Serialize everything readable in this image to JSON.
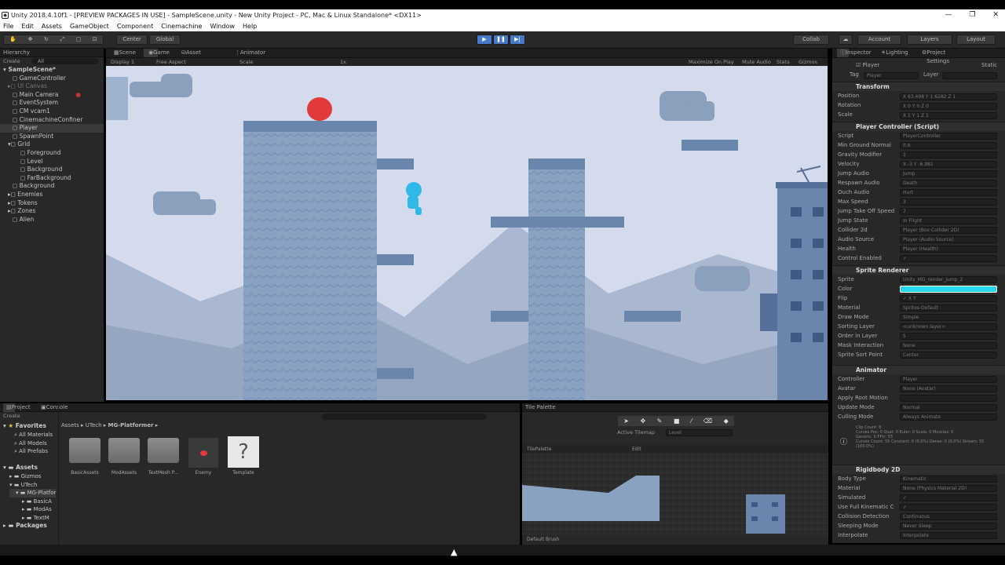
{
  "window": {
    "title": "Unity 2018.4.10f1 - [PREVIEW PACKAGES IN USE] - SampleScene.unity - New Unity Project - PC, Mac & Linux Standalone* <DX11>",
    "min": "—",
    "max": "❐",
    "close": "✕"
  },
  "menu": [
    "File",
    "Edit",
    "Assets",
    "GameObject",
    "Component",
    "Cinemachine",
    "Window",
    "Help"
  ],
  "toolbar": {
    "center": "Center",
    "global": "Global",
    "collab": "Collab",
    "account": "Account",
    "layers": "Layers",
    "layout": "Layout"
  },
  "scene_tabs": {
    "scene": "Scene",
    "game": "Game",
    "asset_store": "Asset Store",
    "animator": "Animator"
  },
  "game_bar": {
    "display": "Display 1",
    "aspect": "Free Aspect",
    "scale_label": "Scale",
    "scale_value": "1x",
    "maximize": "Maximize On Play",
    "mute": "Mute Audio",
    "stats": "Stats",
    "gizmos": "Gizmos"
  },
  "hierarchy": {
    "tab": "Hierarchy",
    "create": "Create",
    "search": "All",
    "items": [
      "SampleScene*",
      "GameController",
      "UI Canvas",
      "Main Camera",
      "EventSystem",
      "CM vcam1",
      "CinemachineConfiner",
      "Player",
      "SpawnPoint",
      "Grid",
      "Foreground",
      "Level",
      "Background",
      "FarBackground",
      "Background",
      "Enemies",
      "Tokens",
      "Zones",
      "Alien"
    ]
  },
  "inspector": {
    "tabs": {
      "inspector": "Inspector",
      "lighting": "Lighting",
      "project_settings": "Project Settings"
    },
    "object_name": "Player",
    "static": "Static",
    "tag_label": "Tag",
    "tag": "Player",
    "layer_label": "Layer",
    "transform": {
      "title": "Transform",
      "position": "Position",
      "rotation": "Rotation",
      "scale": "Scale",
      "pos": "X  63.498   Y  1.6282   Z  1",
      "rot": "X  0       Y  0       Z  0",
      "scl": "X  1       Y  1       Z  1"
    },
    "controller": {
      "title": "Player Controller (Script)",
      "rows": [
        [
          "Script",
          "PlayerController"
        ],
        [
          "Min Ground Normal",
          "0.6"
        ],
        [
          "Gravity Modifier",
          "1"
        ],
        [
          "Velocity",
          "X  -3      Y  -6.981"
        ],
        [
          "Jump Audio",
          "Jump"
        ],
        [
          "Respawn Audio",
          "Death"
        ],
        [
          "Ouch Audio",
          "Hurt"
        ],
        [
          "Max Speed",
          "3"
        ],
        [
          "Jump Take Off Speed",
          "7"
        ],
        [
          "Jump State",
          "In Flight"
        ],
        [
          "Collider 2d",
          "Player (Box Collider 2D)"
        ],
        [
          "Audio Source",
          "Player (Audio Source)"
        ],
        [
          "Health",
          "Player (Health)"
        ],
        [
          "Control Enabled",
          "✓"
        ]
      ]
    },
    "sprite": {
      "title": "Sprite Renderer",
      "rows": [
        [
          "Sprite",
          "Unity_MG_render_jump_2"
        ],
        [
          "Color",
          ""
        ],
        [
          "Flip",
          "✓ X   Y"
        ],
        [
          "Material",
          "Sprites-Default"
        ],
        [
          "Draw Mode",
          "Simple"
        ],
        [
          "Sorting Layer",
          "<unknown layer>"
        ],
        [
          "Order in Layer",
          "5"
        ],
        [
          "Mask Interaction",
          "None"
        ],
        [
          "Sprite Sort Point",
          "Center"
        ]
      ]
    },
    "animator": {
      "title": "Animator",
      "rows": [
        [
          "Controller",
          "Player"
        ],
        [
          "Avatar",
          "None (Avatar)"
        ],
        [
          "Apply Root Motion",
          ""
        ],
        [
          "Update Mode",
          "Normal"
        ],
        [
          "Culling Mode",
          "Always Animate"
        ]
      ],
      "info": "Clip Count: 8\nCurves Pos: 0 Quat: 0 Euler: 0 Scale: 0 Muscles: 0\nGeneric: 0 PPtr: 55\nCurves Count: 55 Constant: 0 (0.0%) Dense: 0 (0.0%) Stream: 55 (100.0%)"
    },
    "rigidbody": {
      "title": "Rigidbody 2D",
      "rows": [
        [
          "Body Type",
          "Kinematic"
        ],
        [
          "Material",
          "None (Physics Material 2D)"
        ],
        [
          "Simulated",
          "✓"
        ],
        [
          "Use Full Kinematic C",
          "✓"
        ],
        [
          "Collision Detection",
          "Continuous"
        ],
        [
          "Sleeping Mode",
          "Never Sleep"
        ],
        [
          "Interpolate",
          "Interpolate"
        ]
      ]
    }
  },
  "project": {
    "tabs": {
      "project": "Project",
      "console": "Console"
    },
    "create": "Create",
    "favorites": "Favorites",
    "fav_items": [
      "All Materials",
      "All Models",
      "All Prefabs"
    ],
    "assets": "Assets",
    "asset_tree": [
      "Gizmos",
      "UTech",
      "MG-Platfor",
      "BasicA",
      "ModAs",
      "TextM"
    ],
    "packages": "Packages",
    "breadcrumb": [
      "Assets",
      "UTech",
      "MG-Platformer"
    ],
    "files": [
      "BasicAssets",
      "ModAssets",
      "TextMesh P...",
      "Enemy",
      "Template"
    ]
  },
  "tile_palette": {
    "tab": "Tile Palette",
    "active_tilemap_label": "Active Tilemap",
    "active_tilemap": "Level",
    "palette": "TilePalette",
    "edit": "Edit",
    "brush": "Default Brush"
  },
  "colors": {
    "play_accent": "#4a78c8",
    "sky": "#d4dbed",
    "tile": "#8aa2c2",
    "player": "#2fb8e8",
    "enemy": "#e23a3a",
    "sprite_color": "#29d6f0"
  }
}
